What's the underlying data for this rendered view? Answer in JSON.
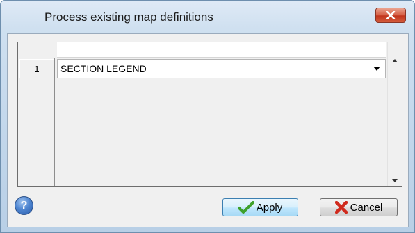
{
  "window": {
    "title": "Process existing map definitions",
    "close_icon": "close-icon"
  },
  "grid": {
    "rows": [
      {
        "number": "1",
        "value": "SECTION LEGEND"
      }
    ]
  },
  "footer": {
    "help_icon": "help-icon",
    "help_glyph": "?",
    "apply_label": "Apply",
    "cancel_label": "Cancel"
  },
  "colors": {
    "close_button": "#c2351d",
    "apply_border": "#3c7fb1",
    "apply_check": "#3fa12b",
    "cancel_x": "#d02a1d",
    "help_button": "#2a5cab"
  }
}
